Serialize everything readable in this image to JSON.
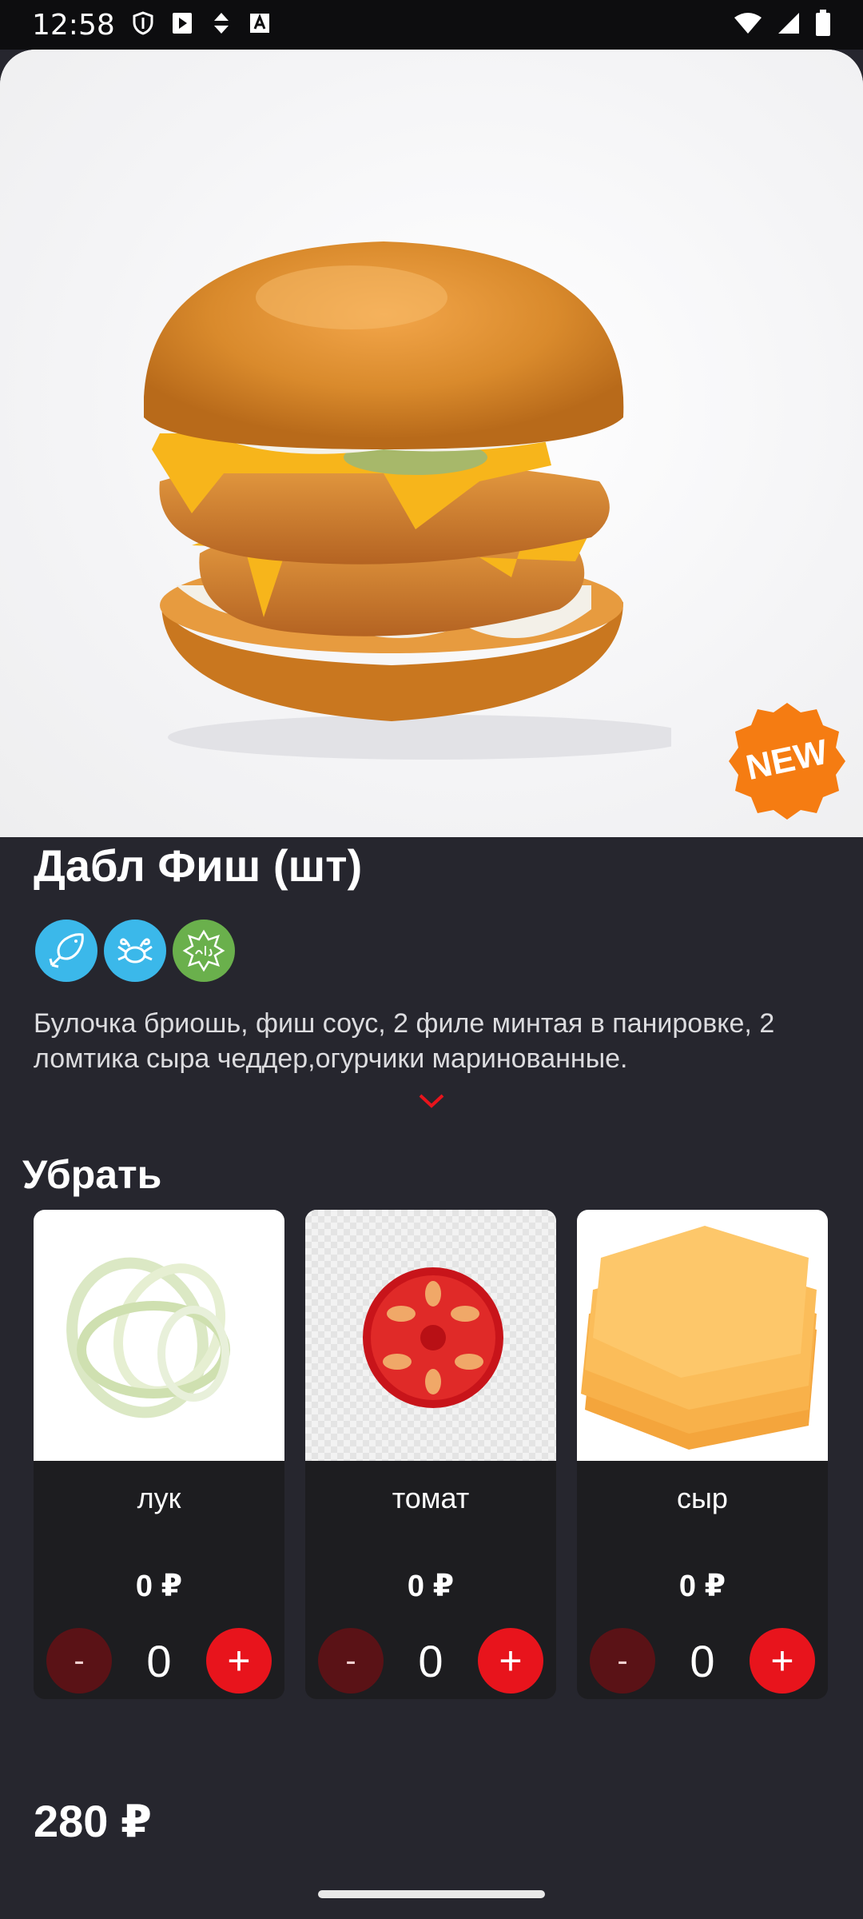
{
  "status_bar": {
    "time": "12:58",
    "left_icons": [
      "shield-icon",
      "play-store-icon",
      "data-saver-icon",
      "font-icon"
    ],
    "right_icons": [
      "wifi-icon",
      "signal-icon",
      "battery-icon"
    ]
  },
  "product": {
    "title": "Дабл Фиш (шт)",
    "badge": "NEW",
    "tags": [
      "fish-icon",
      "seafood-icon",
      "halal-icon"
    ],
    "description": "Булочка бриошь, фиш соус, 2 филе минтая в панировке, 2 ломтика сыра  чеддер,огурчики маринованные."
  },
  "remove_section": {
    "title": "Убрать",
    "items": [
      {
        "name": "лук",
        "price": "0 ₽",
        "qty": "0",
        "minus": "-",
        "plus": "+"
      },
      {
        "name": "томат",
        "price": "0 ₽",
        "qty": "0",
        "minus": "-",
        "plus": "+"
      },
      {
        "name": "сыр",
        "price": "0 ₽",
        "qty": "0",
        "minus": "-",
        "plus": "+"
      }
    ]
  },
  "total": "280 ₽",
  "colors": {
    "background": "#26262e",
    "accent_red": "#e8141c",
    "minus_button": "#5a1216",
    "card_bg": "#1d1d20",
    "badge_orange": "#f57c12",
    "tag_blue": "#3bb8ea",
    "tag_green": "#6ab04c"
  }
}
